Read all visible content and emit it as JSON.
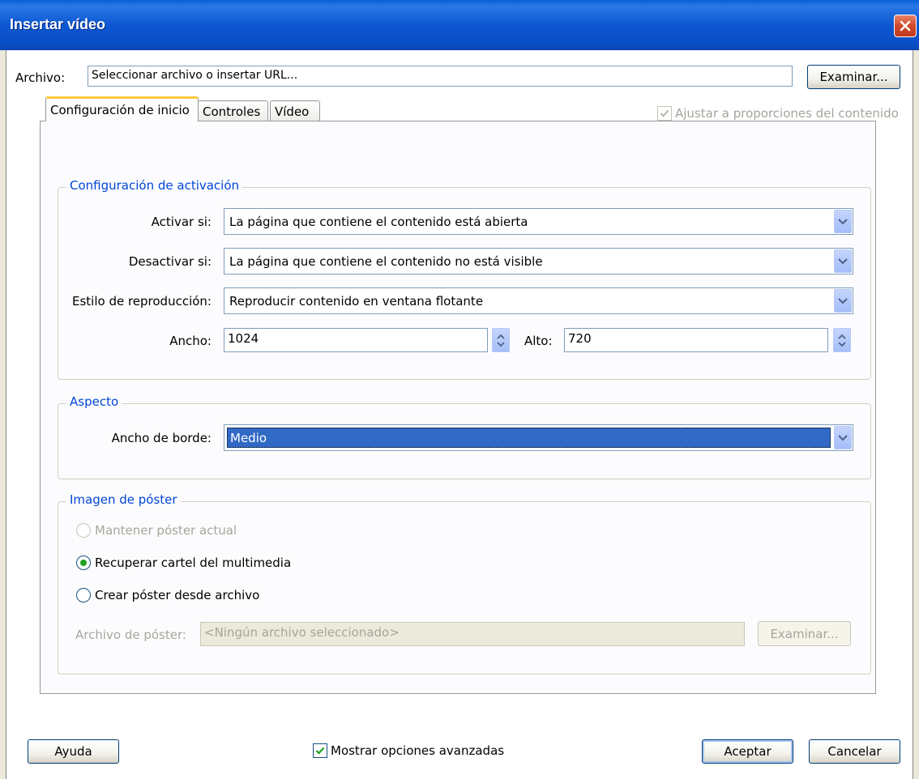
{
  "window": {
    "title": "Insertar vídeo"
  },
  "file": {
    "label": "Archivo:",
    "value": "Seleccionar archivo o insertar URL...",
    "browse_label": "Examinar..."
  },
  "fit_checkbox": {
    "label": "Ajustar a proporciones del contenido",
    "checked": true,
    "enabled": false
  },
  "tabs": [
    {
      "label": "Configuración de inicio",
      "active": true
    },
    {
      "label": "Controles",
      "active": false
    },
    {
      "label": "Vídeo",
      "active": false
    }
  ],
  "activation": {
    "legend": "Configuración de activación",
    "activate_label": "Activar si:",
    "activate_value": "La página que contiene el contenido está abierta",
    "deactivate_label": "Desactivar si:",
    "deactivate_value": "La página que contiene el contenido no está visible",
    "playback_label": "Estilo de reproducción:",
    "playback_value": "Reproducir contenido en ventana flotante",
    "width_label": "Ancho:",
    "width_value": "1024",
    "height_label": "Alto:",
    "height_value": "720"
  },
  "appearance": {
    "legend": "Aspecto",
    "border_label": "Ancho de borde:",
    "border_value": "Medio"
  },
  "poster": {
    "legend": "Imagen de póster",
    "keep_label": "Mantener póster actual",
    "retrieve_label": "Recuperar cartel del multimedia",
    "create_label": "Crear póster desde archivo",
    "selected": "retrieve",
    "file_label": "Archivo de póster:",
    "file_value": "<Ningún archivo seleccionado>",
    "browse_label": "Examinar..."
  },
  "footer": {
    "help_label": "Ayuda",
    "advanced_label": "Mostrar opciones avanzadas",
    "advanced_checked": true,
    "ok_label": "Aceptar",
    "cancel_label": "Cancelar"
  }
}
